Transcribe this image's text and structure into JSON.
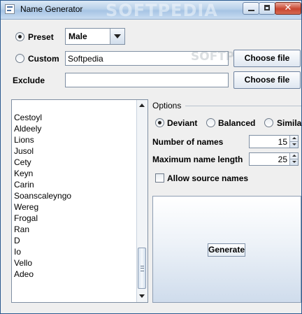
{
  "window": {
    "title": "Name Generator",
    "watermark": "SOFTPEDIA"
  },
  "source": {
    "preset_label": "Preset",
    "preset_selected": true,
    "preset_value": "Male",
    "custom_label": "Custom",
    "custom_selected": false,
    "custom_value": "Softpedia",
    "exclude_label": "Exclude",
    "exclude_value": "",
    "choose_file_label": "Choose file"
  },
  "names": [
    "Cestoyl",
    "Aldeely",
    "Lions",
    "Jusol",
    "Cety",
    "Keyn",
    "Carin",
    "Soanscaleyngo",
    "Wereg",
    "Frogal",
    "Ran",
    "D",
    "Io",
    "Vello",
    "Adeo"
  ],
  "options": {
    "title": "Options",
    "modes": [
      "Deviant",
      "Balanced",
      "Simila"
    ],
    "selected_mode": "Deviant",
    "number_label": "Number of names",
    "number_value": "15",
    "max_length_label": "Maximum name length",
    "max_length_value": "25",
    "allow_source_label": "Allow source names",
    "allow_source_checked": false
  },
  "generate_label": "Generate"
}
